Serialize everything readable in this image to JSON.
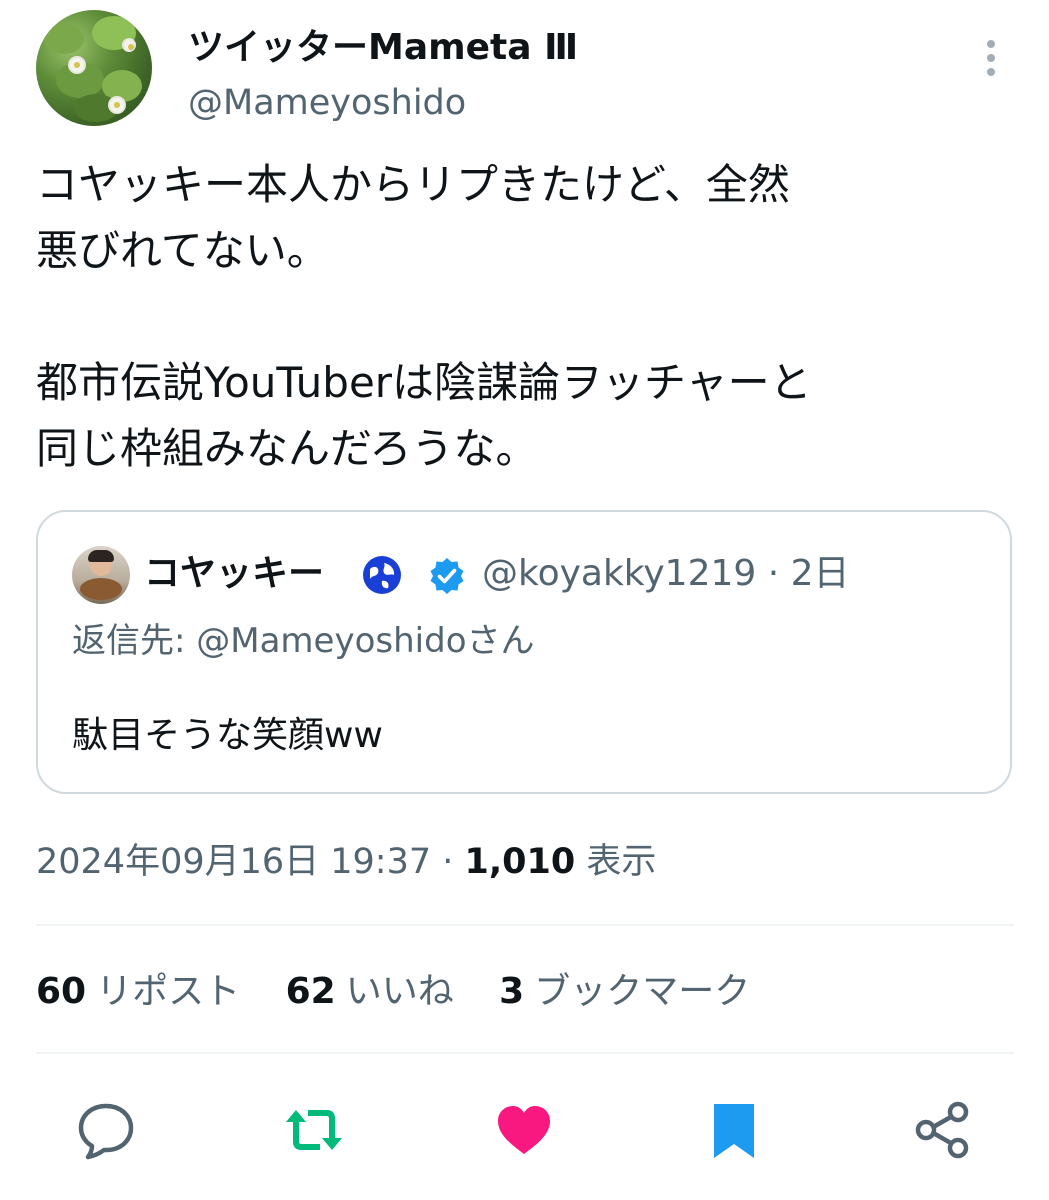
{
  "author": {
    "display_name": "ツイッターMameta Ⅲ",
    "handle": "@Mameyoshido",
    "avatar_icon": "strawberry-plant-avatar"
  },
  "tweet": {
    "text": "コヤッキー本人からリプきたけど、全然\n悪びれてない。\n\n都市伝説YouTuberは陰謀論ヲッチャーと\n同じ枠組みなんだろうな。",
    "timestamp": "2024年09月16日 19:37",
    "separator": " · ",
    "views_count": "1,010",
    "views_label": " 表示"
  },
  "quote": {
    "display_name": "コヤッキー",
    "handle_time": "@koyakky1219 · 2日",
    "reply_prefix": "返信先: ",
    "reply_mention": "@Mameyoshidoさん",
    "text": "駄目そうな笑顔ww",
    "verified_color": "#1d9bf0",
    "globe_color": "#1a3fd6"
  },
  "stats": {
    "reposts_num": "60",
    "reposts_label": "リポスト",
    "likes_num": "62",
    "likes_label": "いいね",
    "bookmarks_num": "3",
    "bookmarks_label": "ブックマーク"
  },
  "actions": {
    "reply_icon": "comment-icon",
    "repost_icon": "repost-icon",
    "like_icon": "heart-icon",
    "bookmark_icon": "bookmark-icon",
    "share_icon": "share-icon",
    "repost_color": "#00ba7c",
    "like_color": "#f91880",
    "bookmark_color": "#1d9bf0",
    "neutral_color": "#536471"
  }
}
